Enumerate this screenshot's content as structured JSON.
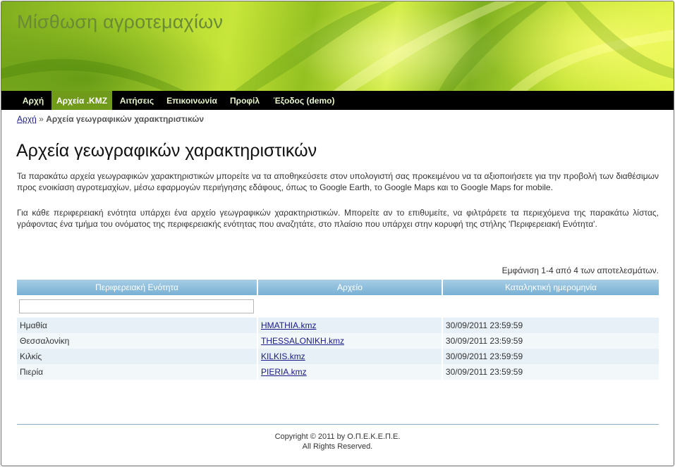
{
  "header": {
    "site_title": "Μίσθωση αγροτεμαχίων"
  },
  "nav": {
    "items": [
      {
        "label": "Αρχή",
        "active": false
      },
      {
        "label": "Αρχεία .KMZ",
        "active": true
      },
      {
        "label": "Αιτήσεις",
        "active": false
      },
      {
        "label": "Επικοινωνία",
        "active": false
      },
      {
        "label": "Προφίλ",
        "active": false
      },
      {
        "label": "Έξοδος (demo)",
        "active": false
      }
    ]
  },
  "breadcrumb": {
    "home": "Αρχή",
    "separator": "»",
    "current": "Αρχεία γεωγραφικών χαρακτηριστικών"
  },
  "main": {
    "heading": "Αρχεία γεωγραφικών χαρακτηριστικών",
    "paragraph1": "Τα παρακάτω αρχεία γεωγραφικών χαρακτηριστικών μπορείτε να τα αποθηκεύσετε στον υπολογιστή σας προκειμένου να τα αξιοποιήσετε για την προβολή των διαθέσιμων προς ενοικίαση αγροτεμαχίων, μέσω εφαρμογών περιήγησης εδάφους, όπως το Google Earth, το Google Maps και το Google Maps for mobile.",
    "paragraph2": "Για κάθε περιφερειακή ενότητα υπάρχει ένα αρχείο γεωγραφικών χαρακτηριστικών. Μπορείτε αν το επιθυμείτε, να φιλτράρετε τα περιεχόμενα της παρακάτω λίστας, γράφοντας ένα τμήμα του ονόματος της περιφερειακής ενότητας που αναζητάτε, στο πλαίσιο που υπάρχει στην κορυφή της στήλης 'Περιφερειακή Ενότητα'."
  },
  "grid": {
    "summary": "Εμφάνιση 1-4 από 4 των αποτελεσμάτων.",
    "columns": [
      "Περιφερειακή Ενότητα",
      "Αρχείο",
      "Καταληκτική ημερομηνία"
    ],
    "filter": {
      "value": "",
      "placeholder": ""
    },
    "rows": [
      {
        "region": "Ημαθία",
        "file": "HMATHIA.kmz",
        "deadline": "30/09/2011 23:59:59"
      },
      {
        "region": "Θεσσαλονίκη",
        "file": "THESSALONIKH.kmz",
        "deadline": "30/09/2011 23:59:59"
      },
      {
        "region": "Κιλκίς",
        "file": "KILKIS.kmz",
        "deadline": "30/09/2011 23:59:59"
      },
      {
        "region": "Πιερία",
        "file": "PIERIA.kmz",
        "deadline": "30/09/2011 23:59:59"
      }
    ]
  },
  "footer": {
    "copyright": "Copyright © 2011 by Ο.Π.Ε.Κ.Ε.Π.Ε.",
    "rights": "All Rights Reserved."
  }
}
